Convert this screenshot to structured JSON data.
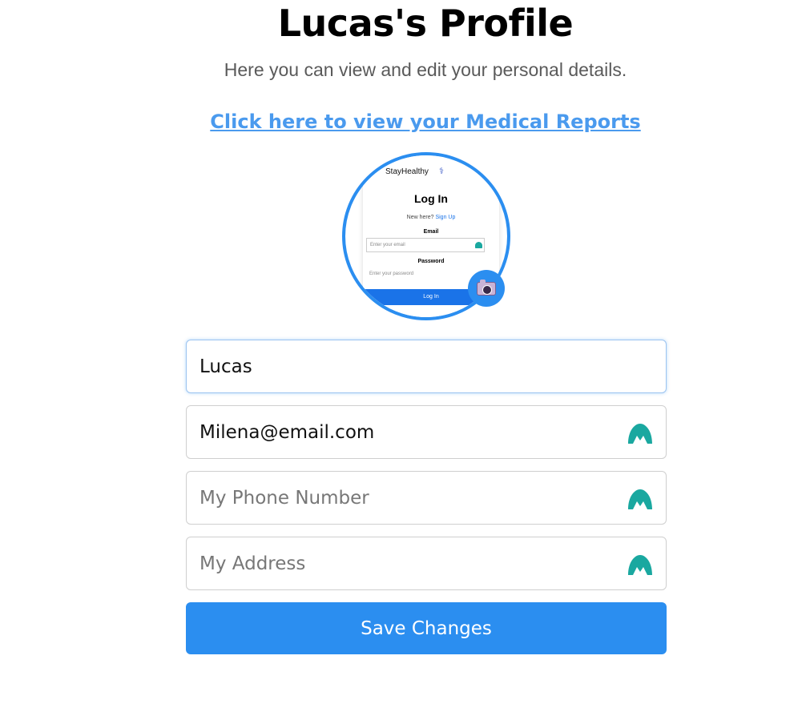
{
  "header": {
    "title": "Lucas's Profile",
    "subtitle": "Here you can view and edit your personal details.",
    "reports_link": "Click here to view your Medical Reports"
  },
  "avatar_preview": {
    "brand": "StayHealthy",
    "heading": "Log In",
    "new_here": "New here?",
    "signup": "Sign Up",
    "email_label": "Email",
    "email_placeholder": "Enter your email",
    "password_label": "Password",
    "password_placeholder": "Enter your password",
    "button": "Log In"
  },
  "form": {
    "name": {
      "value": "Lucas"
    },
    "email": {
      "value": "Milena@email.com"
    },
    "phone": {
      "value": "",
      "placeholder": "My Phone Number"
    },
    "address": {
      "value": "",
      "placeholder": "My Address"
    },
    "save_label": "Save Changes"
  },
  "colors": {
    "accent": "#2b8ef0",
    "link": "#4a9aee",
    "field_icon": "#1aa8a0"
  },
  "icons": {
    "camera": "camera-icon",
    "field_extension": "autofill-extension-icon"
  }
}
